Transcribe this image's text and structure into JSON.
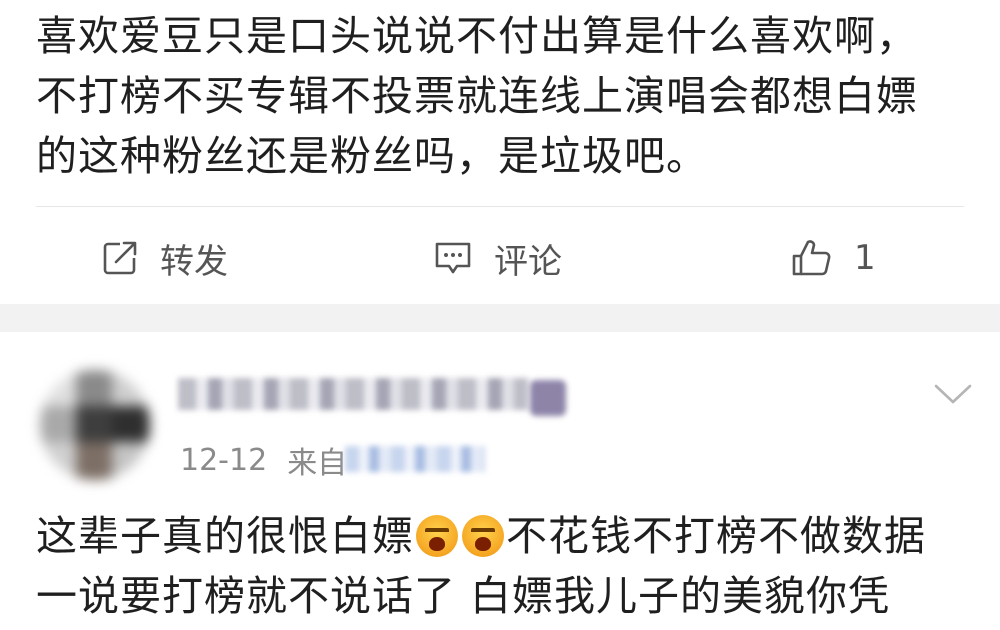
{
  "post": {
    "lines": [
      "喜欢爱豆只是口头说说不付出算是什么喜欢啊，",
      "不打榜不买专辑不投票就连线上演唱会都想白嫖",
      "的这种粉丝还是粉丝吗，是垃圾吧。"
    ]
  },
  "actions": {
    "repost_label": "转发",
    "comment_label": "评论",
    "like_count": "1"
  },
  "comment": {
    "date": "12-12",
    "source_prefix": "来自",
    "line1_a": "这辈子真的很恨白嫖",
    "line1_b": "不花钱不打榜不做数据",
    "line2": "一说要打榜就不说话了 白嫖我儿子的美貌你凭",
    "emoji": "angry-face-emoji"
  },
  "colors": {
    "text": "#1f1f1f",
    "secondary": "#8a8a8a",
    "separator_band": "#f2f2f2"
  }
}
